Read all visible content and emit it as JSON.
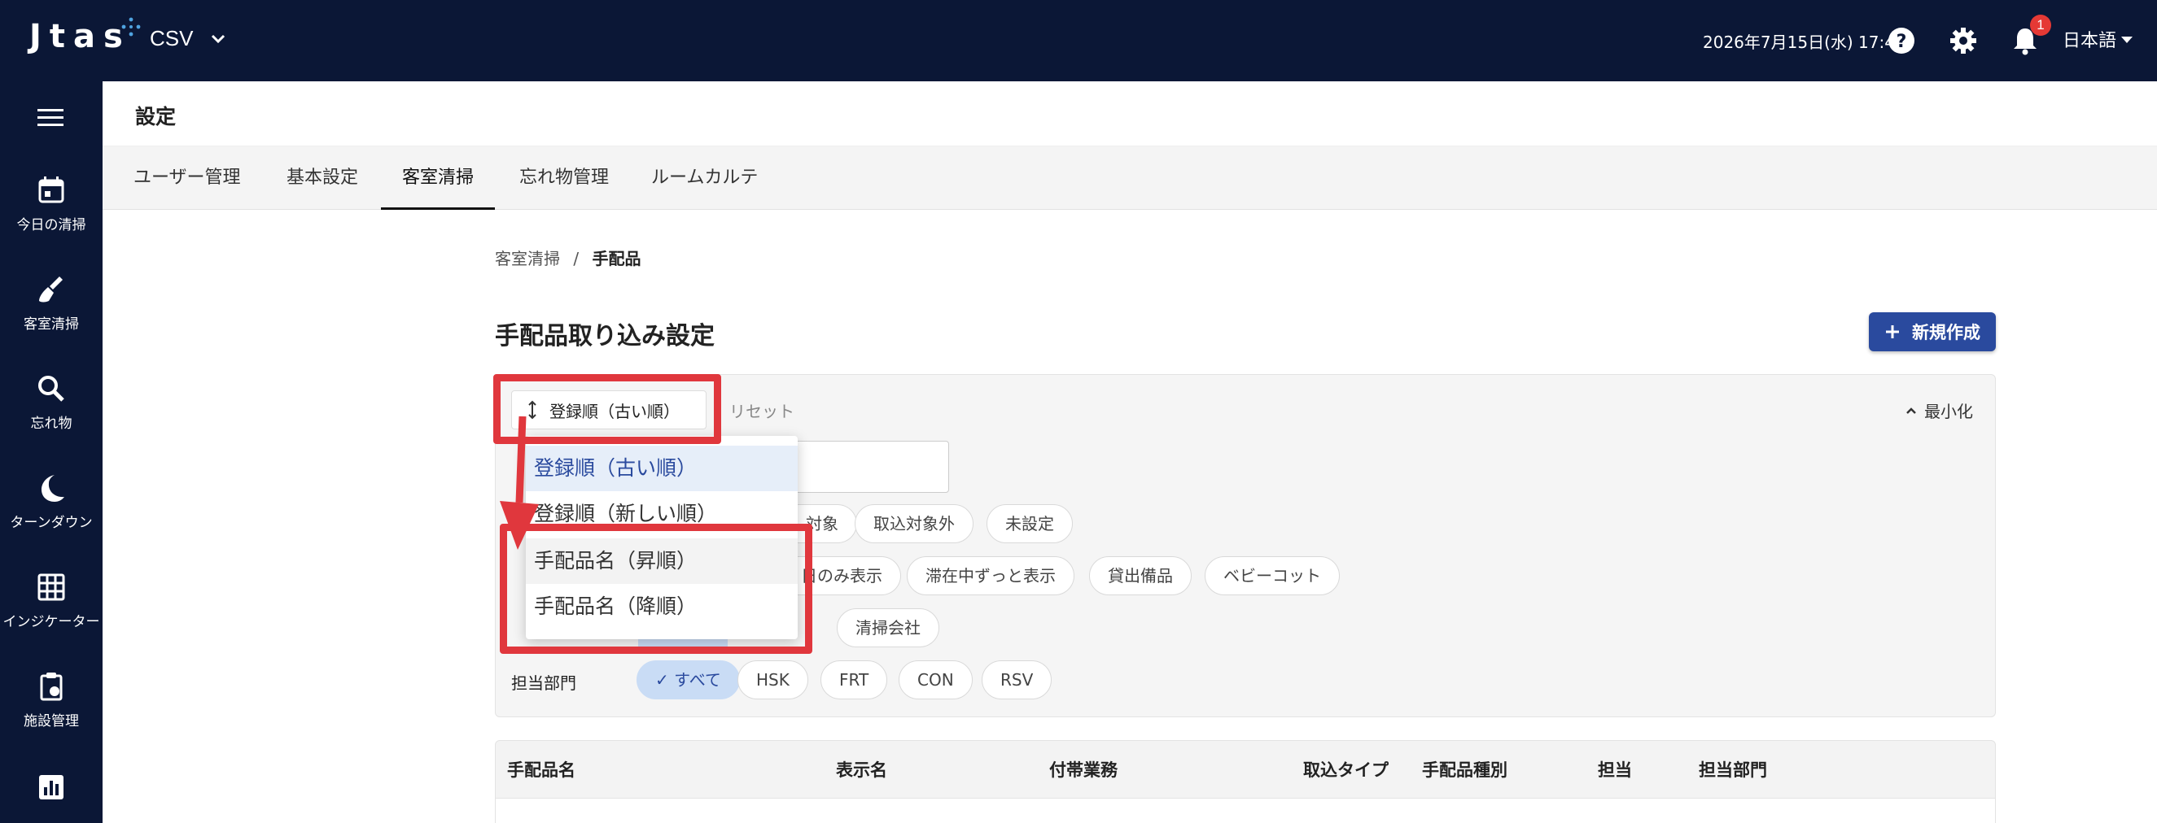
{
  "header": {
    "logo": "Jtas",
    "app_name": "CSV",
    "datetime": "2026年7月15日(水) 17:41",
    "notification_count": "1",
    "language": "日本語"
  },
  "sidebar": {
    "items": [
      {
        "label": "今日の清掃",
        "icon": "calendar-icon"
      },
      {
        "label": "客室清掃",
        "icon": "broom-icon"
      },
      {
        "label": "忘れ物",
        "icon": "search-icon"
      },
      {
        "label": "ターンダウン",
        "icon": "moon-icon"
      },
      {
        "label": "インジケーター",
        "icon": "grid-icon"
      },
      {
        "label": "施設管理",
        "icon": "clipboard-icon"
      },
      {
        "label": "",
        "icon": "chart-icon"
      }
    ]
  },
  "page": {
    "title": "設定",
    "tabs": [
      "ユーザー管理",
      "基本設定",
      "客室清掃",
      "忘れ物管理",
      "ルームカルテ"
    ],
    "active_tab": "客室清掃"
  },
  "breadcrumb": {
    "parent": "客室清掃",
    "separator": "/",
    "current": "手配品"
  },
  "section": {
    "title": "手配品取り込み設定",
    "new_button": "新規作成"
  },
  "filters": {
    "sort_label": "登録順（古い順）",
    "reset": "リセット",
    "minimize": "最小化",
    "row1_chips": [
      "対象",
      "取込対象外",
      "未設定"
    ],
    "row2_chips": [
      "日のみ表示",
      "滞在中ずっと表示",
      "貸出備品",
      "ベビーコット"
    ],
    "row3_chips": [
      "清掃会社"
    ],
    "dept_label": "担当部門",
    "dept_chips": [
      "すべて",
      "HSK",
      "FRT",
      "CON",
      "RSV"
    ]
  },
  "sort_dropdown": {
    "options": [
      "登録順（古い順）",
      "登録順（新しい順）",
      "手配品名（昇順）",
      "手配品名（降順）"
    ]
  },
  "table": {
    "columns": [
      "手配品名",
      "表示名",
      "付帯業務",
      "取込タイプ",
      "手配品種別",
      "担当",
      "担当部門"
    ]
  },
  "colors": {
    "nav_bg": "#0b1736",
    "primary": "#2a4a9e",
    "annotation": "#e0373d",
    "chip_selected": "#c9dcf5"
  }
}
